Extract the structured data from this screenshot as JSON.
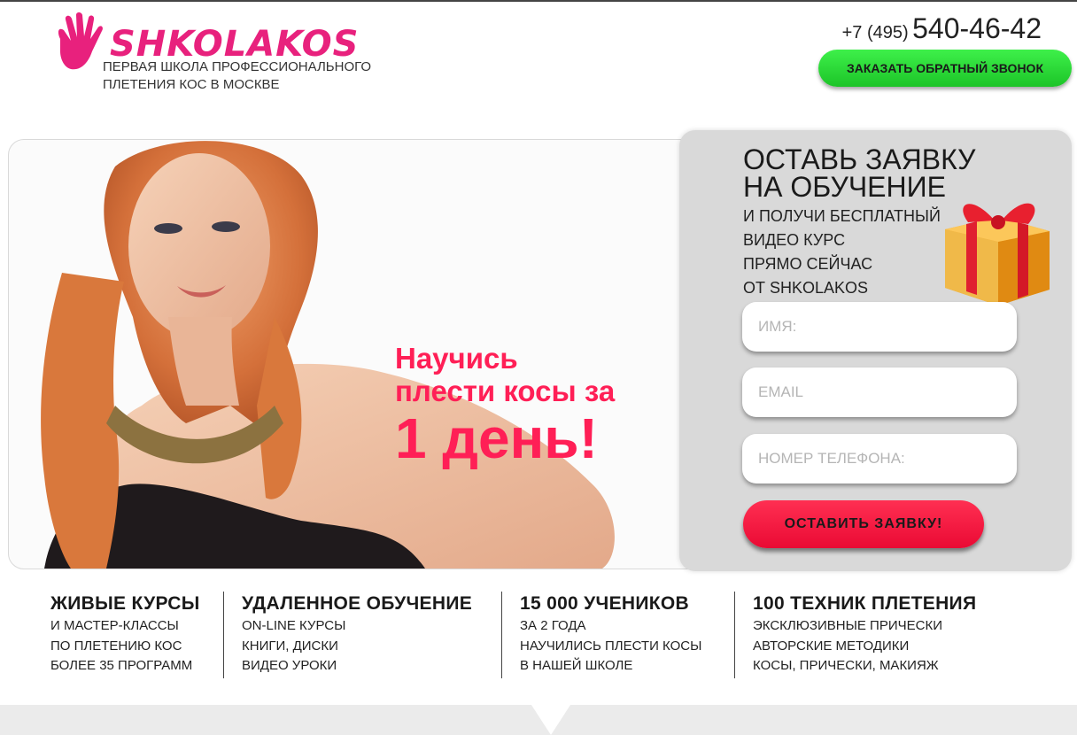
{
  "header": {
    "logo_name": "SHKOLAKOS",
    "logo_tagline": "ПЕРВАЯ ШКОЛА ПРОФЕССИОНАЛЬНОГО ПЛЕТЕНИЯ КОС В МОСКВЕ",
    "phone_code": "+7 (495)",
    "phone_number": "540-46-42",
    "callback_label": "ЗАКАЗАТЬ ОБРАТНЫЙ ЗВОНОК"
  },
  "hero": {
    "headline_line1": "Научись",
    "headline_line2": "плести косы за",
    "headline_big": "1 день!"
  },
  "form": {
    "title_line1": "ОСТАВЬ ЗАЯВКУ",
    "title_line2": "НА ОБУЧЕНИЕ",
    "sub_lines": [
      "И ПОЛУЧИ БЕСПЛАТНЫЙ",
      "ВИДЕО КУРС",
      "ПРЯМО СЕЙЧАС",
      "ОТ SHKOLAKOS"
    ],
    "name_placeholder": "ИМЯ:",
    "email_placeholder": "EMAIL",
    "phone_placeholder": "НОМЕР ТЕЛЕФОНА:",
    "submit_label": "ОСТАВИТЬ ЗАЯВКУ!"
  },
  "features": [
    {
      "title": "ЖИВЫЕ КУРСЫ",
      "lines": [
        "И МАСТЕР-КЛАССЫ",
        "ПО ПЛЕТЕНИЮ КОС",
        "БОЛЕЕ 35 ПРОГРАММ"
      ]
    },
    {
      "title": "УДАЛЕННОЕ ОБУЧЕНИЕ",
      "lines": [
        "ON-LINE КУРСЫ",
        "КНИГИ, ДИСКИ",
        "ВИДЕО УРОКИ"
      ]
    },
    {
      "title": "15 000 УЧЕНИКОВ",
      "lines": [
        "ЗА 2 ГОДА",
        "НАУЧИЛИСЬ ПЛЕСТИ КОСЫ",
        "В НАШЕЙ ШКОЛЕ"
      ]
    },
    {
      "title": "100 ТЕХНИК ПЛЕТЕНИЯ",
      "lines": [
        "ЭКСКЛЮЗИВНЫЕ ПРИЧЕСКИ",
        "АВТОРСКИЕ МЕТОДИКИ",
        "КОСЫ, ПРИЧЕСКИ, МАКИЯЖ"
      ]
    }
  ],
  "colors": {
    "brand_pink": "#e8217d",
    "headline_red": "#ff1f56",
    "callback_green": "#1cc428",
    "submit_red": "#ea0a34"
  },
  "icons": [
    "hand-logo-icon",
    "gift-box-icon"
  ]
}
